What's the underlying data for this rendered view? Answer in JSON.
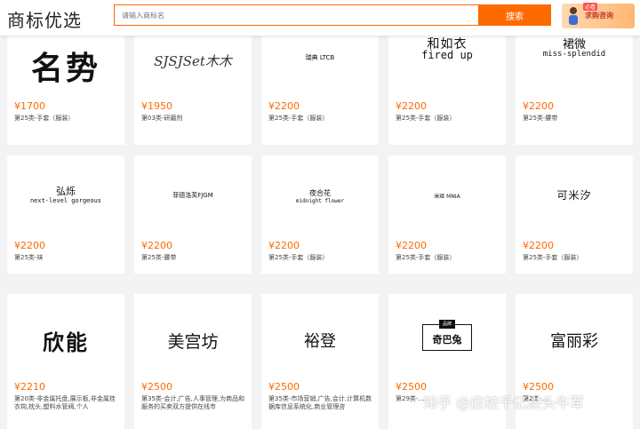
{
  "header": {
    "logo": "商标优选",
    "search_placeholder": "请输入商标名",
    "search_button": "搜索",
    "promo_text": "求购咨询",
    "promo_tag": "必看"
  },
  "cards": [
    {
      "mark": "名势",
      "price": "¥1700",
      "cls": "第25类-手套（服装）"
    },
    {
      "mark": "SJSJSet木木",
      "price": "¥1950",
      "cls": "第03类-研磨剂"
    },
    {
      "mark": "瑞典 LTCB",
      "price": "¥2200",
      "cls": "第25类-手套（服装）"
    },
    {
      "mark": "和如衣",
      "mark2": "fired up",
      "price": "¥2200",
      "cls": "第25类-手套（服装）"
    },
    {
      "mark": "裙微",
      "mark2": "miss-splendid",
      "price": "¥2200",
      "cls": "第25类-腰带"
    },
    {
      "mark": "弘烁",
      "mark2": "next-level gorgeous",
      "price": "¥2200",
      "cls": "第25类-袜"
    },
    {
      "mark": "菲德洛芙FJGM",
      "price": "¥2200",
      "cls": "第25类-腰带"
    },
    {
      "mark": "夜合花",
      "mark2": "midnight flower",
      "price": "¥2200",
      "cls": "第25类-手套（服装）"
    },
    {
      "mark": "米娅 MNIA",
      "price": "¥2200",
      "cls": "第25类-手套（服装）"
    },
    {
      "mark": "可米汐",
      "price": "¥2200",
      "cls": "第25类-手套（服装）"
    },
    {
      "mark": "欣能",
      "price": "¥2210",
      "cls": "第20类-非金属托盘,展示板,非金属挂衣钩,枕头,塑料水管阀,个人"
    },
    {
      "mark": "美宫坊",
      "price": "¥2500",
      "cls": "第35类-会计,广告,人事管理,为商品和服务的买卖双方提供在线市"
    },
    {
      "mark": "裕登",
      "price": "¥2500",
      "cls": "第35类-市场营销,广告,会计,计算机数据库信息系统化,商业管理咨"
    },
    {
      "mark": "奇巴兔",
      "mark_top": "品牌",
      "price": "¥2500",
      "cls": "第29类-…"
    },
    {
      "mark": "富丽彩",
      "price": "¥2500",
      "cls": "第2类-…"
    }
  ],
  "watermark": "知乎 @应校千亿进头牛军"
}
